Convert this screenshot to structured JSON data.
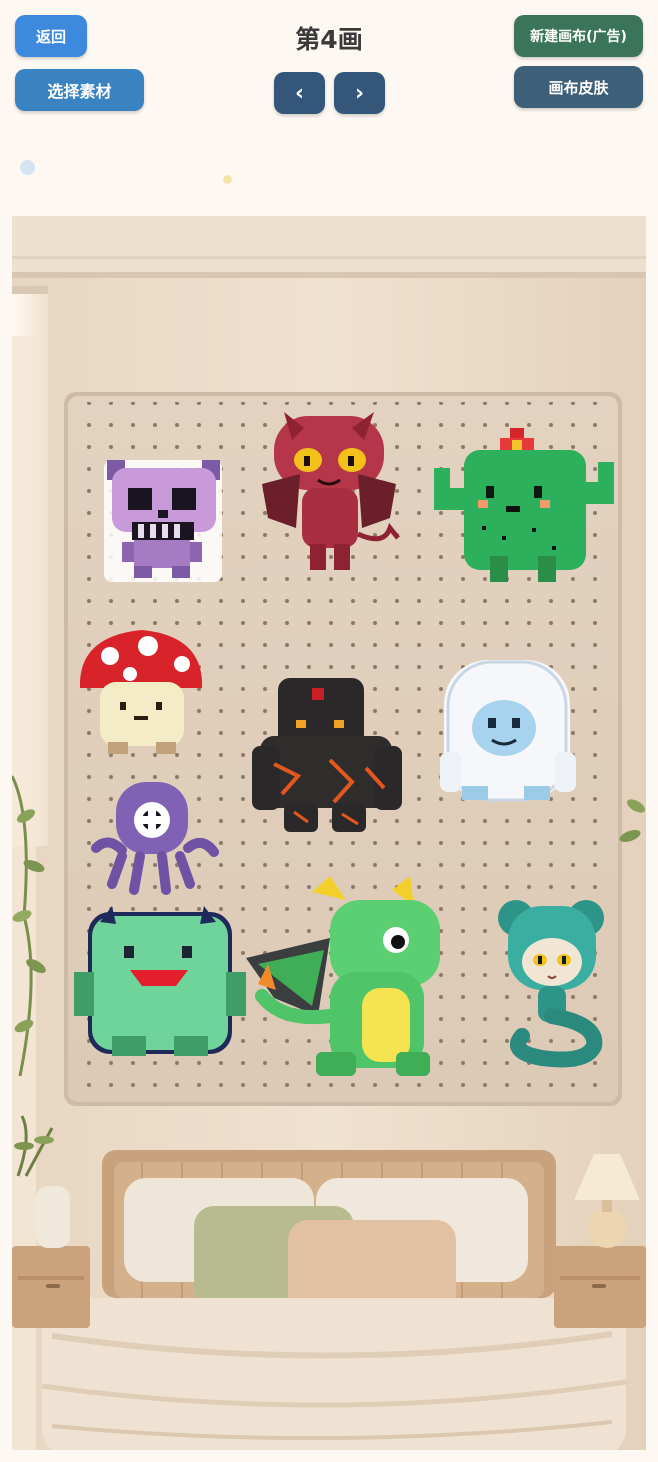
{
  "header": {
    "back_label": "返回",
    "title": "第4画",
    "new_canvas_label": "新建画布(广告)",
    "select_material_label": "选择素材",
    "canvas_skin_label": "画布皮肤",
    "prev_label": "‹",
    "next_label": "›"
  },
  "colors": {
    "page_bg": "#fdf8f1",
    "back_button": "#3d89dd",
    "select_material_button": "#3a83c2",
    "new_canvas_button": "#3b7559",
    "canvas_skin_button": "#3d5f78",
    "nav_button": "#34567a"
  },
  "canvas": {
    "stickers": [
      {
        "name": "purple-skull-monster-sticker"
      },
      {
        "name": "red-devil-sticker"
      },
      {
        "name": "cactus-monster-sticker"
      },
      {
        "name": "mushroom-creature-sticker"
      },
      {
        "name": "lava-golem-sticker"
      },
      {
        "name": "white-yeti-sticker"
      },
      {
        "name": "purple-octopus-sticker"
      },
      {
        "name": "green-blob-monster-sticker"
      },
      {
        "name": "green-dragon-sticker"
      },
      {
        "name": "teal-snake-girl-sticker"
      }
    ]
  }
}
